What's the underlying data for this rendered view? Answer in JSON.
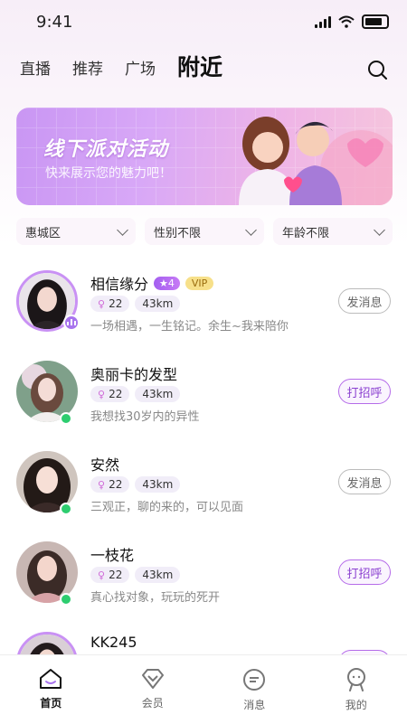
{
  "status_bar": {
    "time": "9:41"
  },
  "top_nav": {
    "tabs": [
      {
        "label": "直播",
        "active": false
      },
      {
        "label": "推荐",
        "active": false
      },
      {
        "label": "广场",
        "active": false
      },
      {
        "label": "附近",
        "active": true
      }
    ],
    "search_icon": "search-icon"
  },
  "banner": {
    "title": "线下派对活动",
    "subtitle": "快来展示您的魅力吧！"
  },
  "filters": [
    {
      "label": "惠城区"
    },
    {
      "label": "性别不限"
    },
    {
      "label": "年龄不限"
    }
  ],
  "users": [
    {
      "name": "相信缘分",
      "level": "★4",
      "vip": "VIP",
      "age": "22",
      "distance": "43km",
      "bio": "一场相遇，一生铭记。余生~我来陪你",
      "action": "发消息",
      "action_type": "message",
      "status": "live"
    },
    {
      "name": "奥丽卡的发型",
      "level": "",
      "vip": "",
      "age": "22",
      "distance": "43km",
      "bio": "我想找30岁内的异性",
      "action": "打招呼",
      "action_type": "greet",
      "status": "online"
    },
    {
      "name": "安然",
      "level": "",
      "vip": "",
      "age": "22",
      "distance": "43km",
      "bio": "三观正，聊的来的，可以见面",
      "action": "发消息",
      "action_type": "message",
      "status": "online"
    },
    {
      "name": "一枝花",
      "level": "",
      "vip": "",
      "age": "22",
      "distance": "43km",
      "bio": "真心找对象，玩玩的死开",
      "action": "打招呼",
      "action_type": "greet",
      "status": "online"
    },
    {
      "name": "KK245",
      "level": "",
      "vip": "",
      "age": "",
      "distance": "",
      "bio": "",
      "action": "",
      "action_type": "greet",
      "status": ""
    }
  ],
  "tab_bar": [
    {
      "label": "首页",
      "icon": "home-icon",
      "active": true
    },
    {
      "label": "会员",
      "icon": "diamond-icon",
      "active": false
    },
    {
      "label": "消息",
      "icon": "message-icon",
      "active": false
    },
    {
      "label": "我的",
      "icon": "profile-icon",
      "active": false
    }
  ],
  "colors": {
    "accent": "#a874ee",
    "online": "#2dcd6f",
    "vip_bg": "#f7e08a",
    "greet_border": "#b56be9"
  }
}
